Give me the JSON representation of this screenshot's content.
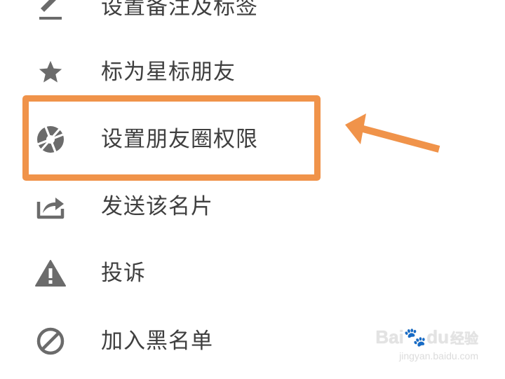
{
  "menu": {
    "items": [
      {
        "label": "设置备注及标签",
        "icon": "edit-icon"
      },
      {
        "label": "标为星标朋友",
        "icon": "star-icon"
      },
      {
        "label": "设置朋友圈权限",
        "icon": "moments-aperture-icon"
      },
      {
        "label": "发送该名片",
        "icon": "share-icon"
      },
      {
        "label": "投诉",
        "icon": "warning-icon"
      },
      {
        "label": "加入黑名单",
        "icon": "block-icon"
      }
    ]
  },
  "annotation": {
    "highlight_color": "#f0934a",
    "highlighted_item": "设置朋友圈权限"
  },
  "watermark": {
    "brand": "Bai",
    "brand_suffix": "du",
    "brand_cn": "经验",
    "url": "jingyan.baidu.com"
  },
  "colors": {
    "icon": "#6b6b6b",
    "text": "#3f3f3f",
    "accent": "#f0934a"
  }
}
